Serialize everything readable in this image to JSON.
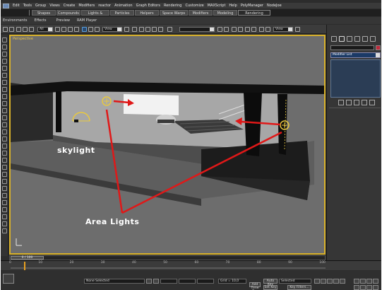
{
  "menubar": {
    "items": [
      "Edit",
      "Tools",
      "Group",
      "Views",
      "Create",
      "Modifiers",
      "reactor",
      "Animation",
      "Graph Editors",
      "Rendering",
      "Customize",
      "MAXScript",
      "Help",
      "PolyManager",
      "NodeJoe"
    ]
  },
  "ribbon": {
    "tabs": [
      "Shapes",
      "Compounds",
      "Lights & Cameras",
      "Particles",
      "Helpers",
      "Space Warps",
      "Modifiers",
      "Modeling",
      "Rendering"
    ],
    "active": "Rendering"
  },
  "envbar": {
    "items": [
      "Environments",
      "Effects",
      "Preview",
      "RAM Player"
    ]
  },
  "toolbar": {
    "selection_filter": "All",
    "ref_coord": "View",
    "ref_coord_2": "View"
  },
  "command_panel": {
    "modifier_list": "Modifier List"
  },
  "viewport": {
    "label": "Perspective"
  },
  "annotations": {
    "skylight": "skylight",
    "area_lights": "Area Lights"
  },
  "timeline": {
    "frame_range": "0 / 100",
    "ticks": [
      "0",
      "10",
      "20",
      "30",
      "40",
      "50",
      "60",
      "70",
      "80",
      "90",
      "100"
    ]
  },
  "status": {
    "selection": "None Selected",
    "grid": "Grid = 10,0",
    "add_time_tag": "Add Time Tag",
    "auto_key": "Auto Key",
    "auto_key_target": "Selected",
    "set_key": "Set Key",
    "key_filters": "Key Filters..."
  },
  "colors": {
    "viewport_border": "#d9b22a",
    "annotation_arrow": "#e01818",
    "light_gizmo": "#e8c840"
  }
}
